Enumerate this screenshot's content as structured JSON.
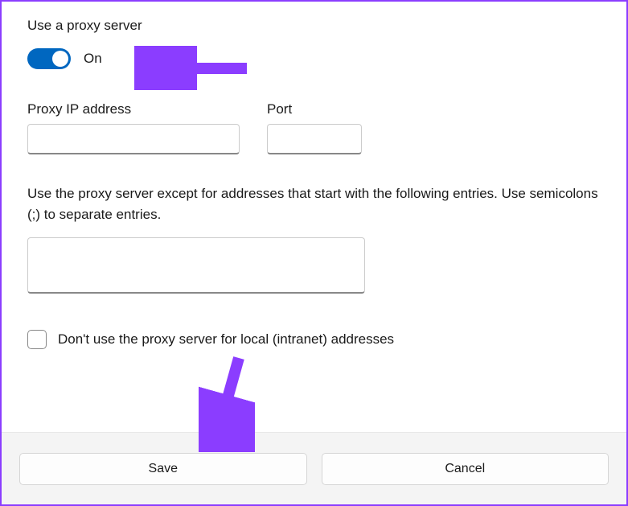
{
  "header": {
    "title": "Use a proxy server"
  },
  "toggle": {
    "state_label": "On"
  },
  "fields": {
    "ip": {
      "label": "Proxy IP address",
      "value": ""
    },
    "port": {
      "label": "Port",
      "value": ""
    }
  },
  "exceptions": {
    "help": "Use the proxy server except for addresses that start with the following entries. Use semicolons (;) to separate entries.",
    "value": ""
  },
  "local": {
    "label": "Don't use the proxy server for local (intranet) addresses"
  },
  "footer": {
    "save": "Save",
    "cancel": "Cancel"
  }
}
